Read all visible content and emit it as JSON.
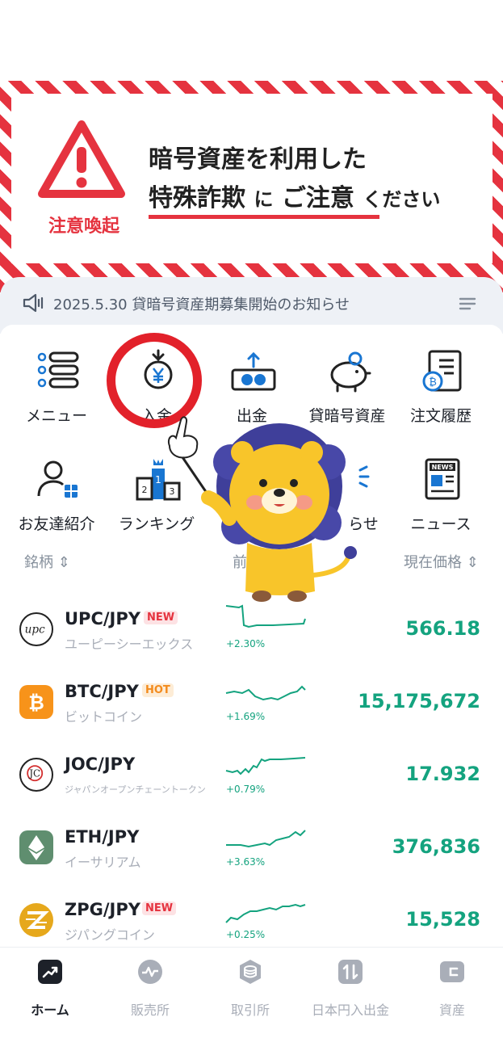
{
  "banner": {
    "warning_label": "注意喚起",
    "line1": "暗号資産を利用した",
    "line2_a": "特殊詐欺",
    "line2_b": "に",
    "line2_c": "ご注意",
    "line2_d": "ください",
    "accent_color": "#e5333f"
  },
  "notice": {
    "text": "2025.5.30 貸暗号資産期募集開始のお知らせ"
  },
  "menu": [
    {
      "label": "メニュー",
      "icon": "menu-list-icon"
    },
    {
      "label": "入金",
      "icon": "deposit-yen-icon"
    },
    {
      "label": "出金",
      "icon": "withdraw-money-icon"
    },
    {
      "label": "貸暗号資産",
      "icon": "piggy-bank-icon"
    },
    {
      "label": "注文履歴",
      "icon": "order-history-icon"
    },
    {
      "label": "お友達紹介",
      "icon": "invite-friend-icon"
    },
    {
      "label": "ランキング",
      "icon": "ranking-podium-icon"
    },
    {
      "label": "らせ",
      "icon": "announcement-icon"
    },
    {
      "label": "ニュース",
      "icon": "news-icon"
    }
  ],
  "market": {
    "col_name": "銘柄",
    "col_change": "前",
    "col_price": "現在価格",
    "rows": [
      {
        "pair": "UPC/JPY",
        "tag": "NEW",
        "name": "ユーピーシーエックス",
        "change": "+2.30%",
        "price": "566.18",
        "logo_color": "#ffffff",
        "logo_text": "upc"
      },
      {
        "pair": "BTC/JPY",
        "tag": "HOT",
        "name": "ビットコイン",
        "change": "+1.69%",
        "price": "15,175,672",
        "logo_color": "#f7931a",
        "logo_text": "₿"
      },
      {
        "pair": "JOC/JPY",
        "tag": "",
        "name": "ジャパンオープンチェーントークン",
        "change": "+0.79%",
        "price": "17.932",
        "logo_color": "#ffffff",
        "logo_text": "JC"
      },
      {
        "pair": "ETH/JPY",
        "tag": "",
        "name": "イーサリアム",
        "change": "+3.63%",
        "price": "376,836",
        "logo_color": "#5f8e6f",
        "logo_text": "◆"
      },
      {
        "pair": "ZPG/JPY",
        "tag": "NEW",
        "name": "ジパングコイン",
        "change": "+0.25%",
        "price": "15,528",
        "logo_color": "#e6a81c",
        "logo_text": "Z"
      }
    ]
  },
  "tabs": [
    {
      "label": "ホーム",
      "icon": "home-chart-icon",
      "active": true
    },
    {
      "label": "販売所",
      "icon": "exchange-wave-icon",
      "active": false
    },
    {
      "label": "取引所",
      "icon": "coin-stack-icon",
      "active": false
    },
    {
      "label": "日本円入出金",
      "icon": "transfer-arrows-icon",
      "active": false
    },
    {
      "label": "資産",
      "icon": "wallet-icon",
      "active": false
    }
  ],
  "colors": {
    "up": "#14a37f",
    "text": "#1d2129",
    "muted": "#86909c"
  }
}
